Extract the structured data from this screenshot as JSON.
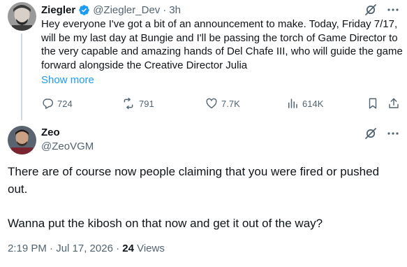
{
  "parent_post": {
    "display_name": "Ziegler",
    "handle": "@Ziegler_Dev",
    "separator": "·",
    "time": "3h",
    "verified_icon": "verified-badge-icon",
    "text": "Hey everyone I've got a bit of an announcement to make. Today, Friday 7/17, will be my last day at Bungie and I'll be passing the torch of Game Director to the very capable and amazing hands of Del Chafe III, who will guide the game forward alongside the Creative Director Julia",
    "show_more": "Show more",
    "stats": {
      "replies": "724",
      "reposts": "791",
      "likes": "7.7K",
      "views": "614K"
    }
  },
  "reply_post": {
    "display_name": "Zeo",
    "handle": "@ZeoVGM",
    "paragraphs": [
      "There are of course now people claiming that you were fired or pushed out.",
      "Wanna put the kibosh on that now and get it out of the way?"
    ],
    "timestamp": "2:19 PM · Jul 17, 2026 · ",
    "views_count": "24",
    "views_label": " Views"
  },
  "colors": {
    "text": "#0f1419",
    "secondary": "#536471",
    "accent": "#1d9bf0",
    "thread_line": "#cfd9de"
  },
  "icons": [
    "reply-icon",
    "repost-icon",
    "like-icon",
    "views-icon",
    "bookmark-icon",
    "share-icon",
    "grok-icon",
    "more-icon"
  ]
}
